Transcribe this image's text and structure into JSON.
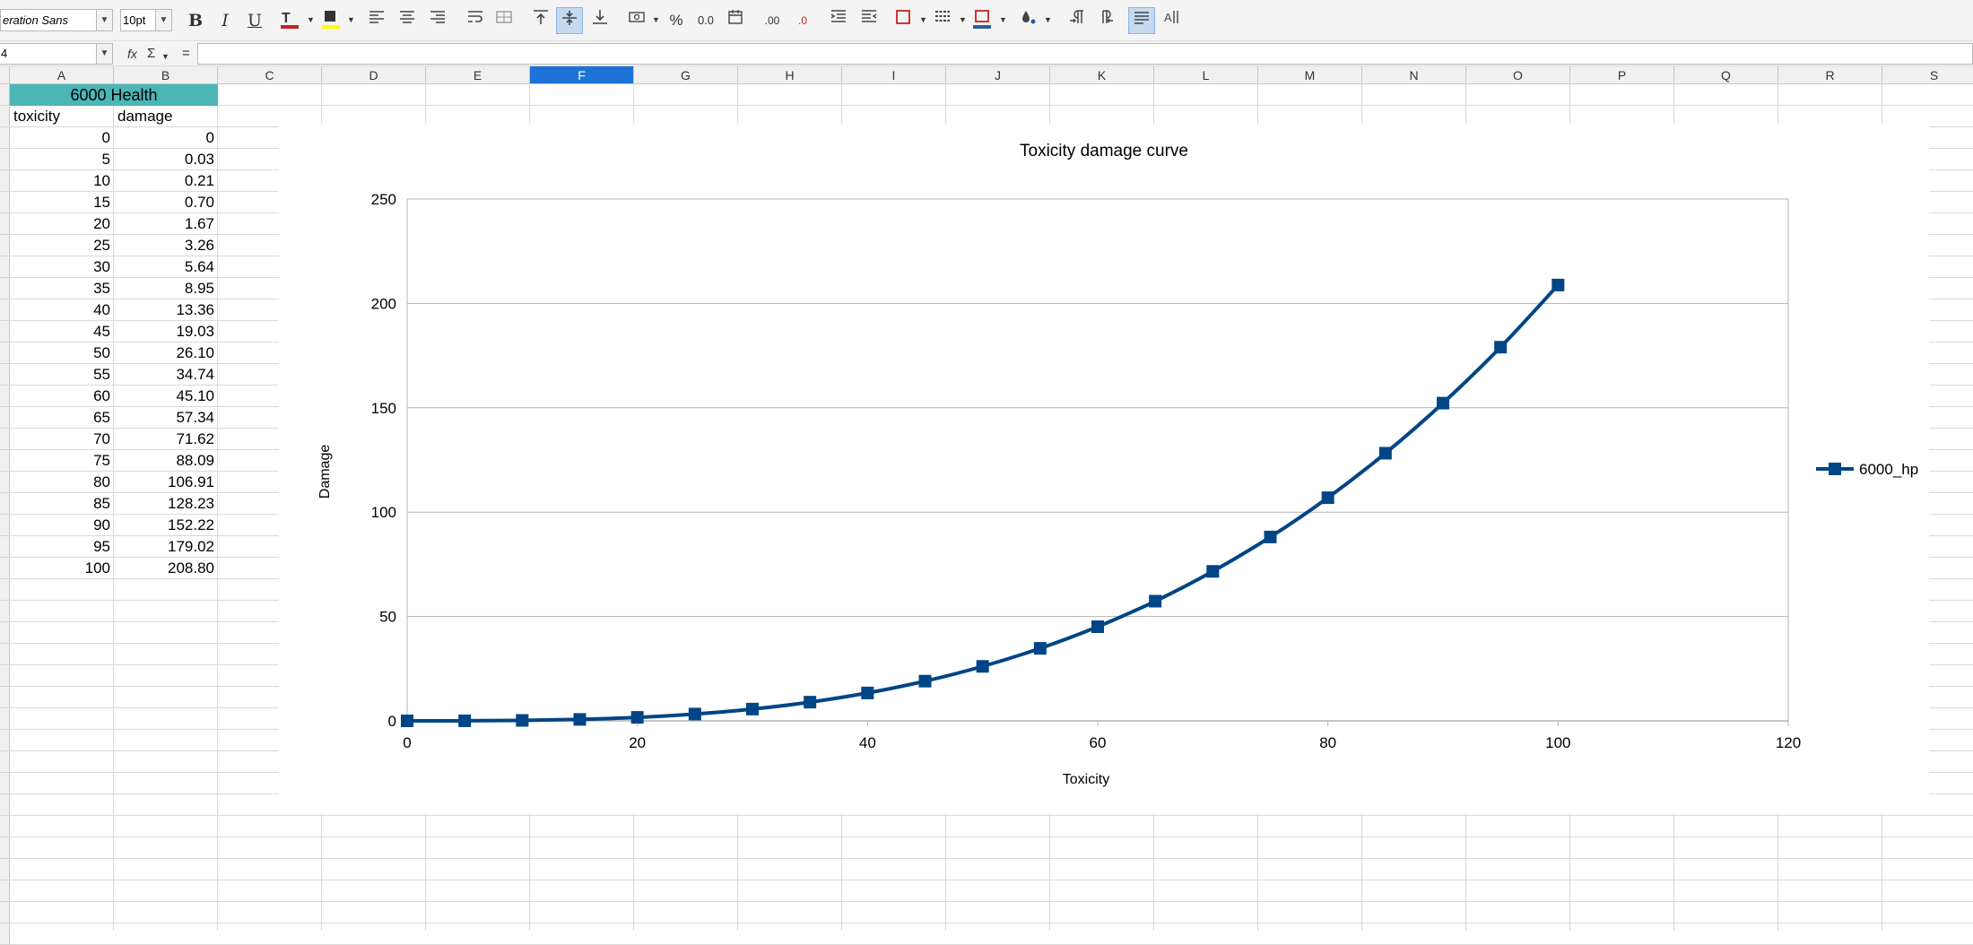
{
  "toolbar": {
    "font_name": "eration Sans",
    "font_size": "10pt",
    "bold_label": "B",
    "italic_label": "I",
    "underline_label": "U"
  },
  "formula_bar": {
    "name_box": "4",
    "function_wizard": "fx",
    "sum_label": "Σ",
    "equals_label": "=",
    "formula_value": ""
  },
  "sheet": {
    "columns": [
      "A",
      "B",
      "C",
      "D",
      "E",
      "F",
      "G",
      "H",
      "I",
      "J",
      "K",
      "L",
      "M",
      "N",
      "O",
      "P",
      "Q",
      "R",
      "S"
    ],
    "selected_column": "F",
    "title": "6000 Health",
    "headers": [
      "toxicity",
      "damage"
    ],
    "rows": [
      [
        "0",
        "0"
      ],
      [
        "5",
        "0.03"
      ],
      [
        "10",
        "0.21"
      ],
      [
        "15",
        "0.70"
      ],
      [
        "20",
        "1.67"
      ],
      [
        "25",
        "3.26"
      ],
      [
        "30",
        "5.64"
      ],
      [
        "35",
        "8.95"
      ],
      [
        "40",
        "13.36"
      ],
      [
        "45",
        "19.03"
      ],
      [
        "50",
        "26.10"
      ],
      [
        "55",
        "34.74"
      ],
      [
        "60",
        "45.10"
      ],
      [
        "65",
        "57.34"
      ],
      [
        "70",
        "71.62"
      ],
      [
        "75",
        "88.09"
      ],
      [
        "80",
        "106.91"
      ],
      [
        "85",
        "128.23"
      ],
      [
        "90",
        "152.22"
      ],
      [
        "95",
        "179.02"
      ],
      [
        "100",
        "208.80"
      ]
    ]
  },
  "chart_data": {
    "type": "line",
    "title": "Toxicity damage curve",
    "xlabel": "Toxicity",
    "ylabel": "Damage",
    "xlim": [
      0,
      120
    ],
    "ylim": [
      0,
      250
    ],
    "xticks": [
      0,
      20,
      40,
      60,
      80,
      100,
      120
    ],
    "yticks": [
      0,
      50,
      100,
      150,
      200,
      250
    ],
    "grid": "horizontal",
    "legend": "right",
    "series": [
      {
        "name": "6000_hp",
        "color": "#004586",
        "marker": "square",
        "x": [
          0,
          5,
          10,
          15,
          20,
          25,
          30,
          35,
          40,
          45,
          50,
          55,
          60,
          65,
          70,
          75,
          80,
          85,
          90,
          95,
          100
        ],
        "y": [
          0,
          0.03,
          0.21,
          0.7,
          1.67,
          3.26,
          5.64,
          8.95,
          13.36,
          19.03,
          26.1,
          34.74,
          45.1,
          57.34,
          71.62,
          88.09,
          106.91,
          128.23,
          152.22,
          179.02,
          208.8
        ]
      }
    ]
  }
}
